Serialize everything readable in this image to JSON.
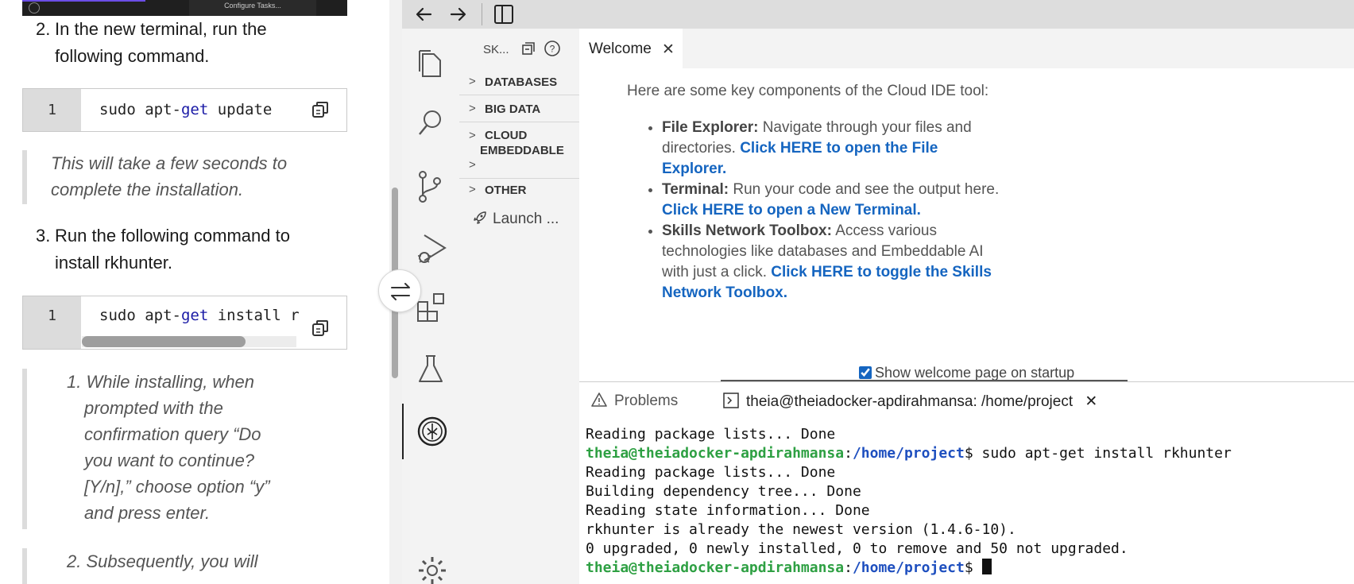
{
  "instructions": {
    "configure_tasks_label": "Configure Tasks...",
    "step2": {
      "number": "2.",
      "line1": "In the new terminal, run the",
      "line2": "following command."
    },
    "code1": {
      "line_number": "1",
      "cmd_sudo": "sudo apt",
      "cmd_dash": "-",
      "cmd_get": "get",
      "cmd_rest": " update"
    },
    "note1": {
      "line1": "This will take a few seconds to",
      "line2": "complete the installation."
    },
    "step3": {
      "number": "3.",
      "line1": "Run the following command to",
      "line2": "install rkhunter."
    },
    "code2": {
      "line_number": "1",
      "cmd_sudo": "sudo apt",
      "cmd_dash": "-",
      "cmd_get": "get",
      "cmd_rest": " install r"
    },
    "substeps": [
      {
        "number": "1.",
        "lines": [
          "While installing, when",
          "prompted with the",
          "confirmation query “Do",
          "you want to continue?",
          "[Y/n],” choose option “y”",
          "and press enter."
        ]
      },
      {
        "number": "2.",
        "lines": [
          "Subsequently, you will"
        ]
      }
    ]
  },
  "sidebar": {
    "title": "SK...",
    "items": [
      {
        "label": "DATABASES"
      },
      {
        "label": "BIG DATA"
      },
      {
        "label": "CLOUD"
      },
      {
        "label": "EMBEDDABLE"
      },
      {
        "label": "OTHER"
      }
    ],
    "launch_label": "Launch ..."
  },
  "editor": {
    "tab_label": "Welcome",
    "intro": "Here are some key components of the Cloud IDE tool:",
    "bullets": [
      {
        "title": "File Explorer:",
        "text": " Navigate through your files and directories. ",
        "link": "Click HERE to open the File Explorer."
      },
      {
        "title": "Terminal:",
        "text": " Run your code and see the output here. ",
        "link": "Click HERE to open a New Terminal."
      },
      {
        "title": "Skills Network Toolbox:",
        "text": " Access various technologies like databases and Embeddable AI with just a click. ",
        "link": "Click HERE to toggle the Skills Network Toolbox."
      }
    ],
    "startup_label": "Show welcome page on startup"
  },
  "panel": {
    "problems_label": "Problems",
    "terminal_tab_label": "theia@theiadocker-apdirahmansa: /home/project",
    "terminal": {
      "line0": "Reading package lists... Done",
      "prompt_user": "theia@theiadocker-apdirahmansa",
      "prompt_sep": ":",
      "prompt_path": "/home/project",
      "prompt_end": "$ ",
      "command": "sudo apt-get install rkhunter",
      "line2": "Reading package lists... Done",
      "line3": "Building dependency tree... Done",
      "line4": "Reading state information... Done",
      "line5": "rkhunter is already the newest version (1.4.6-10).",
      "line6": "0 upgraded, 0 newly installed, 0 to remove and 50 not upgraded."
    }
  }
}
